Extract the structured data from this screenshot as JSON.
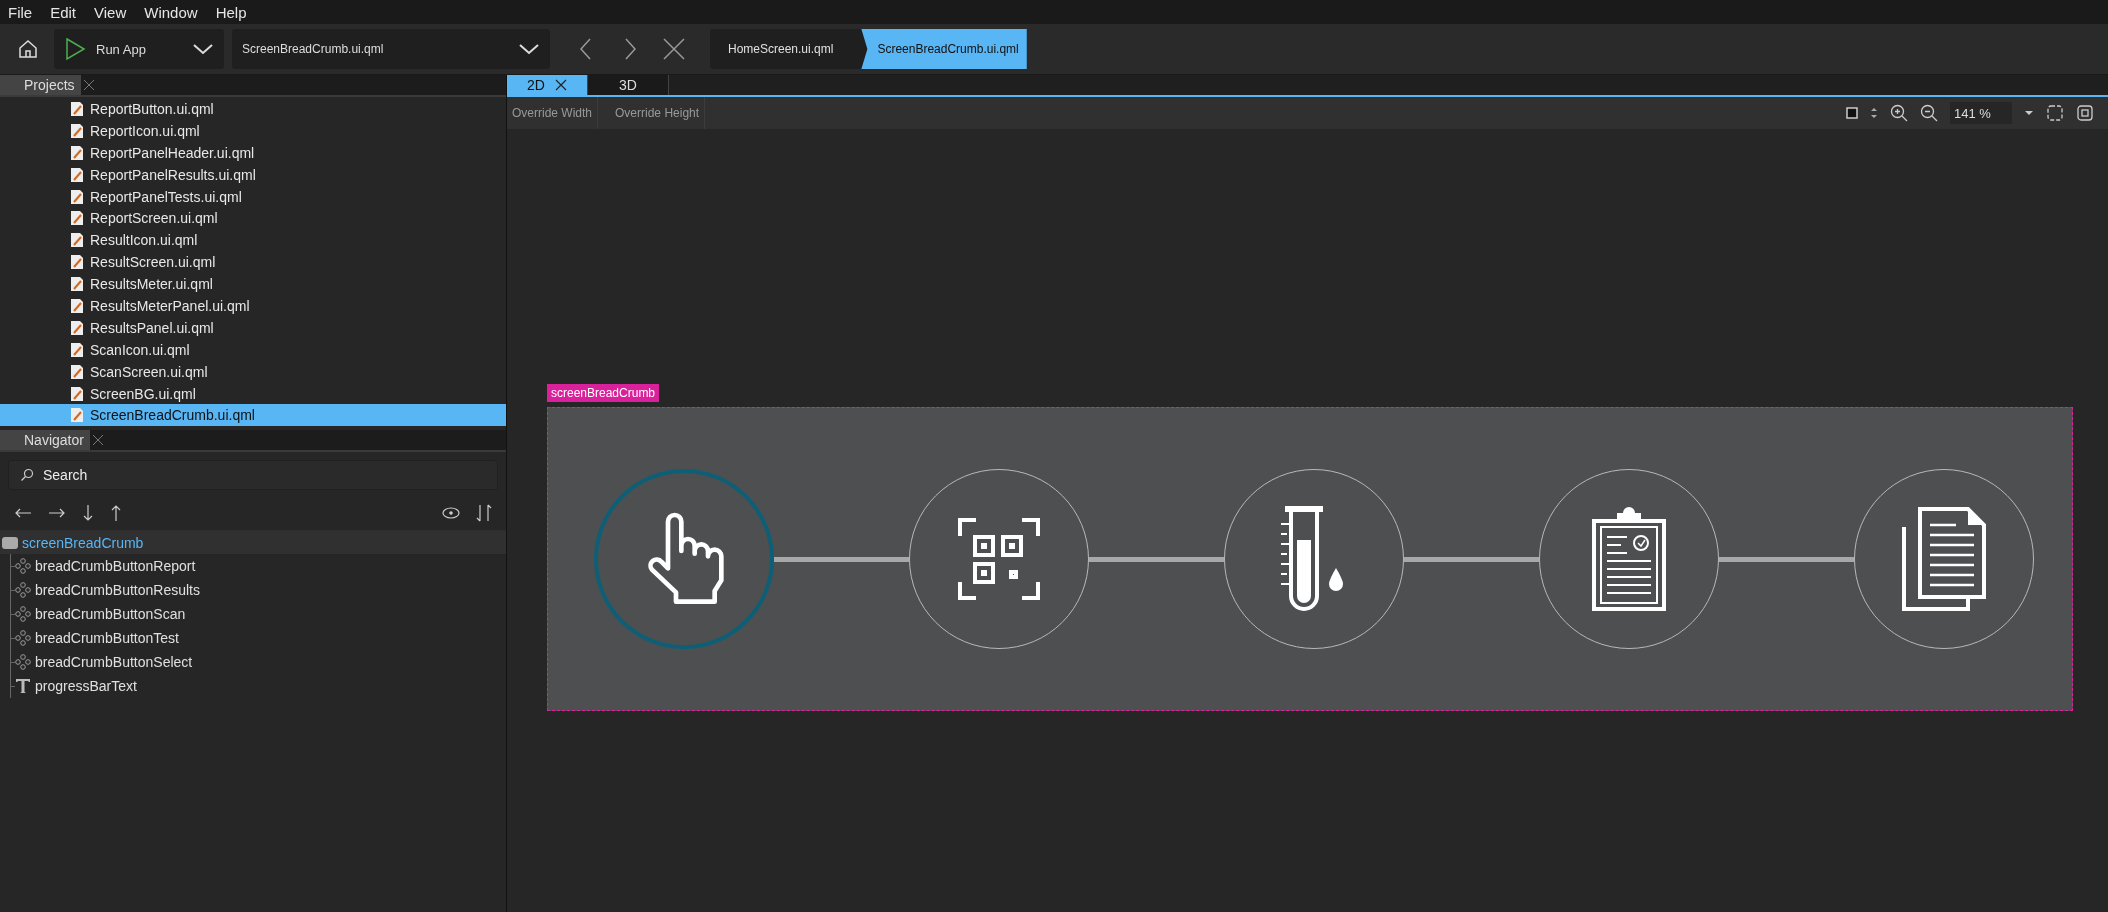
{
  "menu": [
    {
      "label": "File"
    },
    {
      "label": "Edit"
    },
    {
      "label": "View"
    },
    {
      "label": "Window"
    },
    {
      "label": "Help"
    }
  ],
  "toolbar": {
    "run_app": "Run App",
    "open_file": "ScreenBreadCrumb.ui.qml",
    "crumbs": [
      {
        "label": "HomeScreen.ui.qml",
        "selected": false
      },
      {
        "label": "ScreenBreadCrumb.ui.qml",
        "selected": true
      }
    ]
  },
  "projects": {
    "title": "Projects",
    "files": [
      {
        "name": "ReportButton.ui.qml",
        "selected": false
      },
      {
        "name": "ReportIcon.ui.qml",
        "selected": false
      },
      {
        "name": "ReportPanelHeader.ui.qml",
        "selected": false
      },
      {
        "name": "ReportPanelResults.ui.qml",
        "selected": false
      },
      {
        "name": "ReportPanelTests.ui.qml",
        "selected": false
      },
      {
        "name": "ReportScreen.ui.qml",
        "selected": false
      },
      {
        "name": "ResultIcon.ui.qml",
        "selected": false
      },
      {
        "name": "ResultScreen.ui.qml",
        "selected": false
      },
      {
        "name": "ResultsMeter.ui.qml",
        "selected": false
      },
      {
        "name": "ResultsMeterPanel.ui.qml",
        "selected": false
      },
      {
        "name": "ResultsPanel.ui.qml",
        "selected": false
      },
      {
        "name": "ScanIcon.ui.qml",
        "selected": false
      },
      {
        "name": "ScanScreen.ui.qml",
        "selected": false
      },
      {
        "name": "ScreenBG.ui.qml",
        "selected": false
      },
      {
        "name": "ScreenBreadCrumb.ui.qml",
        "selected": true
      }
    ]
  },
  "navigator": {
    "title": "Navigator",
    "search": {
      "placeholder": "Search"
    },
    "tree": {
      "name": "screenBreadCrumb",
      "selected": true,
      "children": [
        {
          "name": "breadCrumbButtonReport",
          "kind": "component"
        },
        {
          "name": "breadCrumbButtonResults",
          "kind": "component"
        },
        {
          "name": "breadCrumbButtonScan",
          "kind": "component"
        },
        {
          "name": "breadCrumbButtonTest",
          "kind": "component"
        },
        {
          "name": "breadCrumbButtonSelect",
          "kind": "component"
        },
        {
          "name": "progressBarText",
          "kind": "text"
        }
      ]
    }
  },
  "editor_tabs": [
    {
      "label": "2D",
      "selected": true
    },
    {
      "label": "3D",
      "selected": false
    }
  ],
  "editor_toolbar": {
    "override_width": "Override Width",
    "override_height": "Override Height",
    "zoom": "141 %"
  },
  "canvas": {
    "label": "screenBreadCrumb",
    "steps": [
      {
        "kind": "hand",
        "selected": true
      },
      {
        "kind": "qr",
        "selected": false
      },
      {
        "kind": "tube",
        "selected": false
      },
      {
        "kind": "clipboard",
        "selected": false
      },
      {
        "kind": "documents",
        "selected": false
      }
    ]
  }
}
